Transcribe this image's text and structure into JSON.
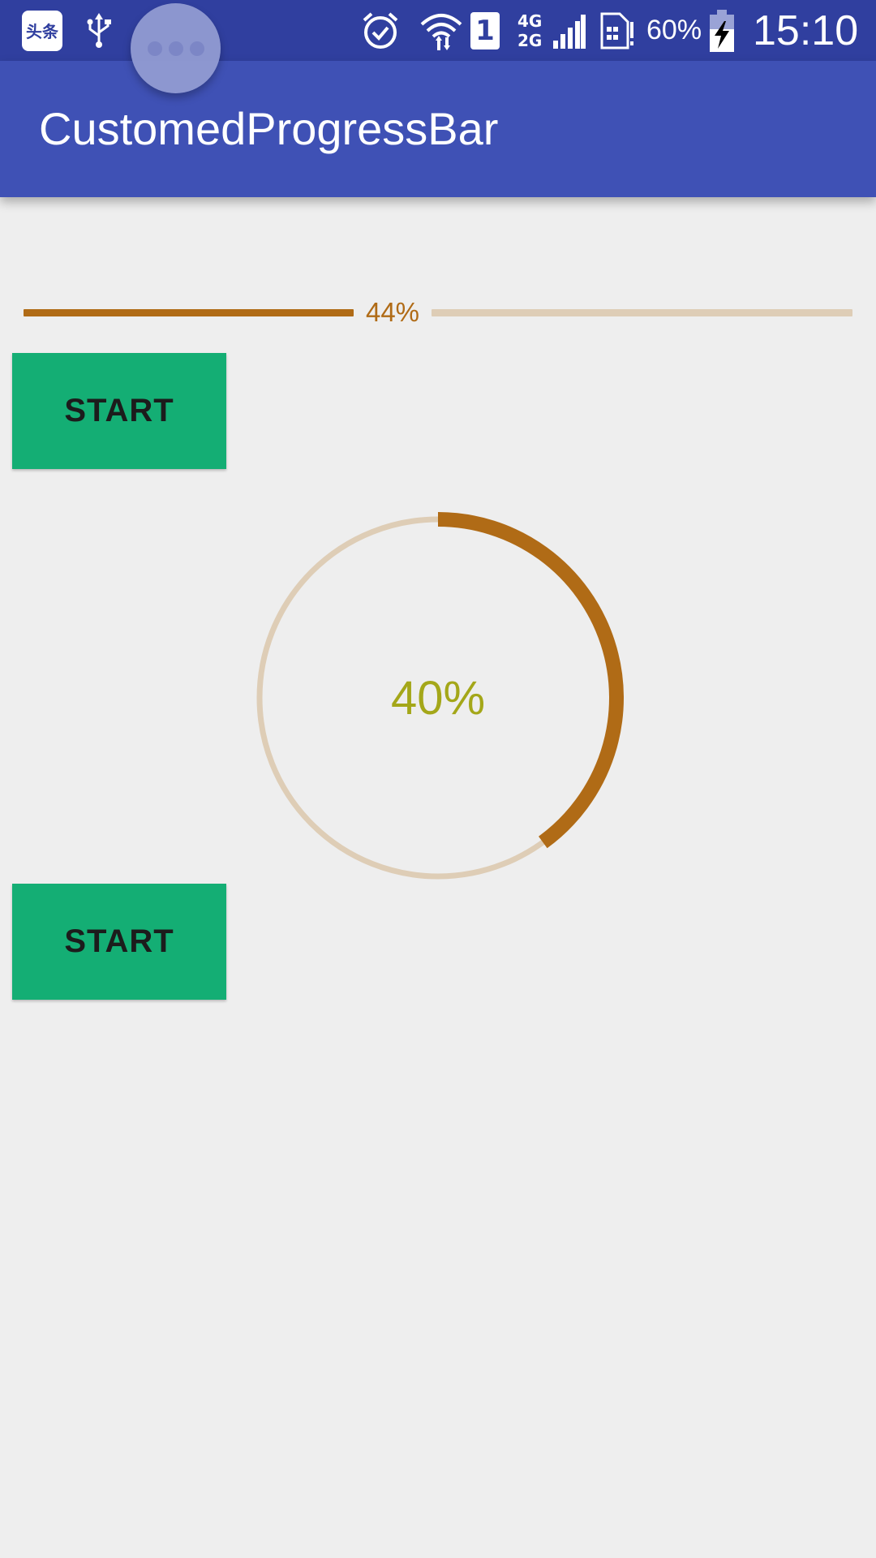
{
  "status_bar": {
    "app_notification": "头条",
    "battery_percent": "60%",
    "clock": "15:10",
    "sim_slot": "1",
    "network_types": [
      "4G",
      "2G"
    ],
    "icons": [
      "toutiao-app-icon",
      "usb-icon",
      "alarm-icon",
      "wifi-icon",
      "sim1-icon",
      "signal-icon",
      "sim-card-icon",
      "battery-charging-icon"
    ]
  },
  "app_bar": {
    "title": "CustomedProgressBar"
  },
  "horizontal_progress": {
    "value": 44,
    "label": "44%",
    "reached_color": "#b06b16",
    "unreached_color": "#decdb6"
  },
  "buttons": {
    "start_1": "START",
    "start_2": "START",
    "color": "#14ae74"
  },
  "circle_progress": {
    "value": 40,
    "label": "40%",
    "reached_color": "#b06b16",
    "unreached_color": "#decdb6",
    "text_color": "#a4a719"
  }
}
